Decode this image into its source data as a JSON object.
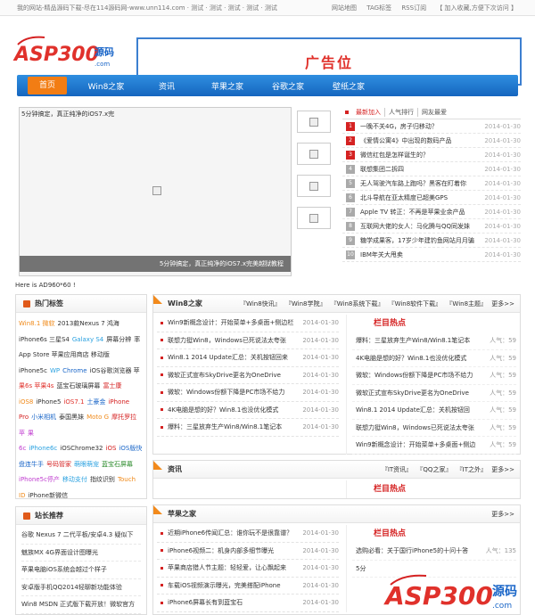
{
  "topbar": {
    "left": "我的网站-精品源码下载-尽在114源码网-www.unn114.com · 测试 · 测试 · 测试 · 测试 · 测试",
    "links": [
      "网站地图",
      "TAG标签",
      "RSS订阅",
      "【 加入收藏,方便下次访问 】"
    ]
  },
  "logo": {
    "text": "ASP300",
    "sub": "源码",
    "domain": ".com"
  },
  "ad": {
    "label": "广告位"
  },
  "nav": {
    "items": [
      "首页",
      "Win8之家",
      "资讯",
      "苹果之家",
      "谷歌之家",
      "壁纸之家"
    ]
  },
  "slider": {
    "caption_top": "5分钟搞定，真正纯净的iOS7.x完",
    "caption_bottom": "5分钟搞定，真正纯净的iOS7.x完美越狱教程"
  },
  "news": {
    "tabs": [
      "最新加入",
      "人气排行",
      "网友最爱"
    ],
    "items": [
      {
        "num": "1",
        "title": "一晚不关4G，房子归移动？",
        "date": "2014-01-30"
      },
      {
        "num": "2",
        "title": "《爱情公寓4》中出现的数码产品",
        "date": "2014-01-30"
      },
      {
        "num": "3",
        "title": "微信红包是怎样诞生的？",
        "date": "2014-01-30"
      },
      {
        "num": "4",
        "title": "联想集团二拆四",
        "date": "2014-01-30"
      },
      {
        "num": "5",
        "title": "无人驾驶汽车路上跑吗？黑客在盯着你",
        "date": "2014-01-30"
      },
      {
        "num": "6",
        "title": "北斗导航在亚太精度已超美GPS",
        "date": "2014-01-30"
      },
      {
        "num": "7",
        "title": "Apple TV 转正：不再是苹果业余产品",
        "date": "2014-01-30"
      },
      {
        "num": "8",
        "title": "互联网大佬的女人：马化腾与QQ同发妹",
        "date": "2014-01-30"
      },
      {
        "num": "9",
        "title": "糖学成果客，17岁少年建钓鱼网站月月骗",
        "date": "2014-01-30"
      },
      {
        "num": "10",
        "title": "IBM年关大甩卖",
        "date": "2014-01-30"
      }
    ]
  },
  "note": "Here is AD960*60 !",
  "hot_tags": {
    "title": "热门标签",
    "tags": [
      {
        "text": "Win8.1 微软",
        "color": "#f08a1a"
      },
      {
        "text": "2013款Nexus 7 鸿海",
        "color": "#333333"
      },
      {
        "text": "iPhone6s 三星S4",
        "color": "#333333"
      },
      {
        "text": "Galaxy S4",
        "color": "#2aa1e0"
      },
      {
        "text": "屏幕分辨",
        "color": "#333333"
      },
      {
        "text": "率 App Store 苹果应用商店 移动版",
        "color": "#333333"
      },
      {
        "text": "iPhone5c",
        "color": "#333333"
      },
      {
        "text": "WP",
        "color": "#2aa1e0"
      },
      {
        "text": "Chrome",
        "color": "#1a66c8"
      },
      {
        "text": "iOS谷歌浏览器 苹",
        "color": "#333333"
      },
      {
        "text": "果6s 苹果4s",
        "color": "#e0312b"
      },
      {
        "text": "蓝宝石玻璃屏幕",
        "color": "#333333"
      },
      {
        "text": "富士康",
        "color": "#d52222"
      },
      {
        "text": "iOS8",
        "color": "#f08a1a"
      },
      {
        "text": "iPhone5",
        "color": "#333333"
      },
      {
        "text": "iOS7.1",
        "color": "#e0312b"
      },
      {
        "text": "土豪金",
        "color": "#1a66c8"
      },
      {
        "text": "iPhone Pro",
        "color": "#d52222"
      },
      {
        "text": "小米相机",
        "color": "#1a66c8"
      },
      {
        "text": "泰国黑妹",
        "color": "#333333"
      },
      {
        "text": "Moto G",
        "color": "#f08a1a"
      },
      {
        "text": "摩托罗拉",
        "color": "#d52222"
      },
      {
        "text": "苹",
        "color": "#c03fd0"
      },
      {
        "text": "果6c",
        "color": "#c03fd0"
      },
      {
        "text": "iPhone6c",
        "color": "#2aa1e0"
      },
      {
        "text": "iOSChrome32",
        "color": "#333333"
      },
      {
        "text": "iOS",
        "color": "#d52222"
      },
      {
        "text": "iOS版快盘连牛手",
        "color": "#1a66c8"
      },
      {
        "text": "号码管家",
        "color": "#d52222"
      },
      {
        "text": "萌眼萌宠",
        "color": "#2aa1e0"
      },
      {
        "text": "蓝宝石屏幕",
        "color": "#2a8a2a"
      },
      {
        "text": "iPhone5c停产",
        "color": "#c03fd0"
      },
      {
        "text": "移动支付",
        "color": "#2aa1e0"
      },
      {
        "text": "指纹识别",
        "color": "#333333"
      },
      {
        "text": "Touch ID",
        "color": "#f08a1a"
      },
      {
        "text": "iPhone新微信",
        "color": "#333333"
      }
    ]
  },
  "station": {
    "title": "站长推荐",
    "items": [
      "谷歌 Nexus 7 二代平板/安卓4.3 疑似下",
      "魅族MX 4G界面设计图曝光",
      "苹果电脑iOS系统会越过个样子",
      "安卓版手机QQ2014轻聊新功能体验",
      "Win8 MSDN 正式版下载开放！微软官方"
    ]
  },
  "sec_win8": {
    "title": "Win8之家",
    "links": [
      "『Win8快讯』",
      "『Win8学院』",
      "『Win8系统下载』",
      "『Win8软件下载』",
      "『Win8主题』",
      "更多>>"
    ],
    "items": [
      {
        "title": "Win9新概念设计：开始菜单+多桌面+侧边栏",
        "date": "2014-01-30"
      },
      {
        "title": "联想力挺Win8，Windows已死说法太夸张",
        "date": "2014-01-30"
      },
      {
        "title": "Win8.1 2014 Update汇总：关机按钮回来",
        "date": "2014-01-30"
      },
      {
        "title": "微软正式宣布SkyDrive更名为OneDrive",
        "date": "2014-01-30"
      },
      {
        "title": "微软：Windows份额下降是PC市场不给力",
        "date": "2014-01-30"
      },
      {
        "title": "4K电脑是想的好？Win8.1也没优化模式",
        "date": "2014-01-30"
      },
      {
        "title": "爆料：三星放弃生产Win8/Win8.1笔记本",
        "date": "2014-01-30"
      }
    ],
    "hot_title": "栏目热点",
    "hot_items": [
      {
        "title": "爆料：三星放弃生产Win8/Win8.1笔记本",
        "views": "人气：59"
      },
      {
        "title": "4K电脑是想的好？Win8.1也没优化模式",
        "views": "人气：59"
      },
      {
        "title": "微软：Windows份额下降是PC市场不给力",
        "views": "人气：59"
      },
      {
        "title": "微软正式宣布SkyDrive更名为OneDrive",
        "views": "人气：59"
      },
      {
        "title": "Win8.1 2014 Update汇总：关机按钮回",
        "views": "人气：59"
      },
      {
        "title": "联想力挺Win8，Windows已死说法太夸张",
        "views": "人气：59"
      },
      {
        "title": "Win9新概念设计：开始菜单+多桌面+侧边",
        "views": "人气：59"
      }
    ]
  },
  "sec_news": {
    "title": "资讯",
    "links": [
      "『IT资讯』",
      "『QQ之家』",
      "『IT之外』",
      "更多>>"
    ],
    "hot_title": "栏目热点"
  },
  "sec_apple": {
    "title": "苹果之家",
    "more": "更多>>",
    "items": [
      {
        "title": "近期iPhone6传闻汇总：谁你玩不是很靠谱？",
        "date": "2014-01-30"
      },
      {
        "title": "iPhone6视频二：机身内部多细节曝光",
        "date": "2014-01-30"
      },
      {
        "title": "苹果商店猎人节主题：轻轻爱，让心飘起来",
        "date": "2014-01-30"
      },
      {
        "title": "车载iOS视频演示曝光，完美搭配iPhone",
        "date": "2014-01-30"
      },
      {
        "title": "iPhone6屏幕长有到蓝宝石",
        "date": "2014-01-30"
      }
    ],
    "hot_title": "栏目热点",
    "hot_items": [
      {
        "title": "选购必看：关于国行iPhone5的十问十答",
        "views": "人气：135"
      },
      {
        "title": "5分",
        "views": ""
      }
    ]
  }
}
